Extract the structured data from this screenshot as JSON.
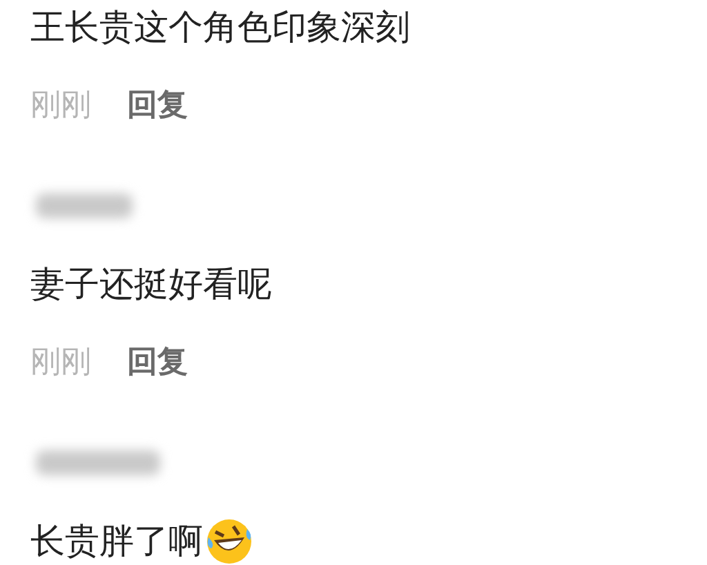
{
  "comments": [
    {
      "author_blurred": false,
      "text": "王长贵这个角色印象深刻",
      "time": "刚刚",
      "reply": "回复"
    },
    {
      "author_blurred": true,
      "text": "妻子还挺好看呢",
      "time": "刚刚",
      "reply": "回复"
    },
    {
      "author_blurred": true,
      "text": "长贵胖了啊",
      "laughing_emoji": true
    }
  ]
}
